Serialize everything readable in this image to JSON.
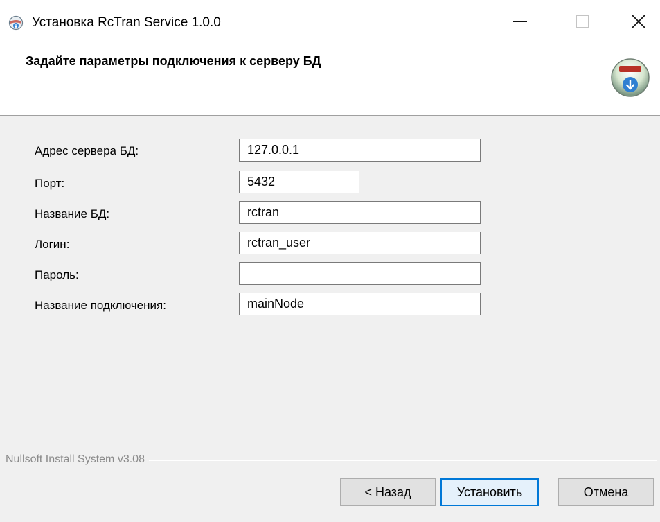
{
  "window": {
    "title": "Установка RcTran Service 1.0.0",
    "icons": {
      "app": "installer-globe-icon",
      "minimize": "minimize-icon",
      "maximize": "maximize-icon",
      "close": "close-icon"
    },
    "close_glyph": "✕"
  },
  "header": {
    "title": "Задайте параметры подключения к серверу БД",
    "icon": "nsis-installer-icon"
  },
  "form": {
    "fields": [
      {
        "label": "Адрес сервера БД:",
        "value": "127.0.0.1"
      },
      {
        "label": "Порт:",
        "value": "5432"
      },
      {
        "label": "Название БД:",
        "value": "rctran"
      },
      {
        "label": "Логин:",
        "value": "rctran_user"
      },
      {
        "label": "Пароль:",
        "value": ""
      },
      {
        "label": "Название подключения:",
        "value": "mainNode"
      }
    ]
  },
  "footer": {
    "branding": "Nullsoft Install System v3.08",
    "back_label": "< Назад",
    "install_label": "Установить",
    "cancel_label": "Отмена"
  },
  "colors": {
    "accent": "#0078d7",
    "dialog_bg": "#f0f0f0",
    "header_bg": "#ffffff"
  }
}
